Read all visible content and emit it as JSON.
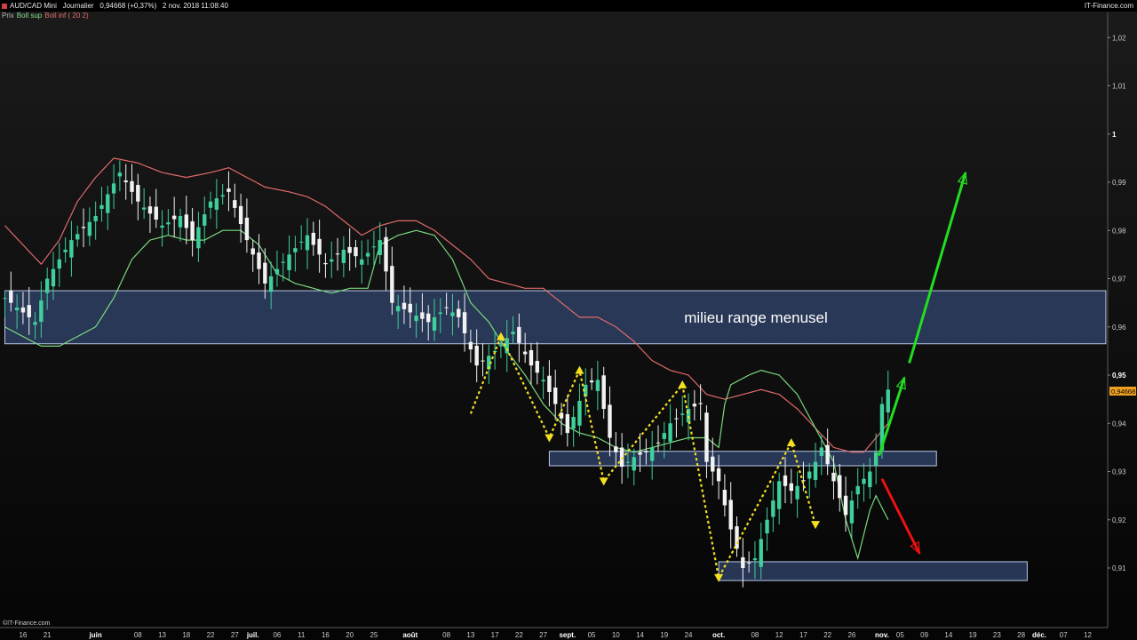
{
  "header": {
    "symbol": "AUD/CAD Mini",
    "period": "Journalier",
    "last": "0,94668",
    "change": "(+0,37%)",
    "datetime": "2 nov. 2018 11:08:40",
    "brand": "IT-Finance.com"
  },
  "legend": {
    "price": "Prix",
    "upper": "Boll sup",
    "lower": "Boll inf ( 20 2)"
  },
  "watermark": "©IT-Finance.com",
  "colors": {
    "up_candle": "#3ecf9a",
    "down_candle": "#f2f2f2",
    "upper_band": "#e06a6a",
    "lower_band": "#7ad87e",
    "zone_fill": "#2c3d60",
    "arrow_up": "#22dd22",
    "arrow_down": "#ee1111",
    "swing_line": "#f5e020",
    "price_tag": "#f0a020"
  },
  "chart_data": {
    "type": "candlestick",
    "ylim": [
      0.9,
      1.025
    ],
    "y_ticks": [
      {
        "v": 1.02,
        "label": "1,02",
        "bold": false
      },
      {
        "v": 1.01,
        "label": "1,01",
        "bold": false
      },
      {
        "v": 1.0,
        "label": "1",
        "bold": true
      },
      {
        "v": 0.99,
        "label": "0,99",
        "bold": false
      },
      {
        "v": 0.98,
        "label": "0,98",
        "bold": false
      },
      {
        "v": 0.97,
        "label": "0,97",
        "bold": false
      },
      {
        "v": 0.96,
        "label": "0,96",
        "bold": false
      },
      {
        "v": 0.95,
        "label": "0,95",
        "bold": true
      },
      {
        "v": 0.94,
        "label": "0,94",
        "bold": false
      },
      {
        "v": 0.93,
        "label": "0,93",
        "bold": false
      },
      {
        "v": 0.92,
        "label": "0,92",
        "bold": false
      },
      {
        "v": 0.91,
        "label": "0,91",
        "bold": false
      }
    ],
    "last_price_label": "0,94668",
    "last_price": 0.94668,
    "x_ticks": [
      {
        "i": 3,
        "label": "16",
        "bold": false
      },
      {
        "i": 7,
        "label": "21",
        "bold": false
      },
      {
        "i": 15,
        "label": "juin",
        "bold": true
      },
      {
        "i": 22,
        "label": "08",
        "bold": false
      },
      {
        "i": 26,
        "label": "13",
        "bold": false
      },
      {
        "i": 30,
        "label": "18",
        "bold": false
      },
      {
        "i": 34,
        "label": "22",
        "bold": false
      },
      {
        "i": 38,
        "label": "27",
        "bold": false
      },
      {
        "i": 41,
        "label": "juil.",
        "bold": true
      },
      {
        "i": 45,
        "label": "06",
        "bold": false
      },
      {
        "i": 49,
        "label": "11",
        "bold": false
      },
      {
        "i": 53,
        "label": "16",
        "bold": false
      },
      {
        "i": 57,
        "label": "20",
        "bold": false
      },
      {
        "i": 61,
        "label": "25",
        "bold": false
      },
      {
        "i": 67,
        "label": "août",
        "bold": true
      },
      {
        "i": 73,
        "label": "08",
        "bold": false
      },
      {
        "i": 77,
        "label": "13",
        "bold": false
      },
      {
        "i": 81,
        "label": "17",
        "bold": false
      },
      {
        "i": 85,
        "label": "22",
        "bold": false
      },
      {
        "i": 89,
        "label": "27",
        "bold": false
      },
      {
        "i": 93,
        "label": "sept.",
        "bold": true
      },
      {
        "i": 97,
        "label": "05",
        "bold": false
      },
      {
        "i": 101,
        "label": "10",
        "bold": false
      },
      {
        "i": 105,
        "label": "14",
        "bold": false
      },
      {
        "i": 109,
        "label": "19",
        "bold": false
      },
      {
        "i": 113,
        "label": "24",
        "bold": false
      },
      {
        "i": 118,
        "label": "oct.",
        "bold": true
      },
      {
        "i": 124,
        "label": "08",
        "bold": false
      },
      {
        "i": 128,
        "label": "12",
        "bold": false
      },
      {
        "i": 132,
        "label": "17",
        "bold": false
      },
      {
        "i": 136,
        "label": "22",
        "bold": false
      },
      {
        "i": 140,
        "label": "26",
        "bold": false
      },
      {
        "i": 145,
        "label": "nov.",
        "bold": true
      },
      {
        "i": 148,
        "label": "05",
        "bold": false
      },
      {
        "i": 152,
        "label": "09",
        "bold": false
      },
      {
        "i": 156,
        "label": "14",
        "bold": false
      },
      {
        "i": 160,
        "label": "19",
        "bold": false
      },
      {
        "i": 164,
        "label": "23",
        "bold": false
      },
      {
        "i": 168,
        "label": "28",
        "bold": false
      },
      {
        "i": 171,
        "label": "déc.",
        "bold": true
      },
      {
        "i": 175,
        "label": "07",
        "bold": false
      },
      {
        "i": 179,
        "label": "12",
        "bold": false
      }
    ],
    "price_key": [
      [
        0,
        0.966
      ],
      [
        5,
        0.961
      ],
      [
        7,
        0.97
      ],
      [
        11,
        0.978
      ],
      [
        15,
        0.983
      ],
      [
        19,
        0.992
      ],
      [
        22,
        0.986
      ],
      [
        26,
        0.981
      ],
      [
        29,
        0.983
      ],
      [
        31,
        0.978
      ],
      [
        34,
        0.986
      ],
      [
        37,
        0.988
      ],
      [
        40,
        0.978
      ],
      [
        43,
        0.969
      ],
      [
        47,
        0.975
      ],
      [
        50,
        0.979
      ],
      [
        53,
        0.973
      ],
      [
        56,
        0.976
      ],
      [
        59,
        0.974
      ],
      [
        62,
        0.978
      ],
      [
        64,
        0.965
      ],
      [
        67,
        0.963
      ],
      [
        70,
        0.961
      ],
      [
        73,
        0.964
      ],
      [
        75,
        0.962
      ],
      [
        78,
        0.952
      ],
      [
        81,
        0.955
      ],
      [
        84,
        0.959
      ],
      [
        87,
        0.952
      ],
      [
        89,
        0.949
      ],
      [
        91,
        0.944
      ],
      [
        93,
        0.938
      ],
      [
        96,
        0.948
      ],
      [
        98,
        0.949
      ],
      [
        100,
        0.937
      ],
      [
        102,
        0.931
      ],
      [
        104,
        0.933
      ],
      [
        106,
        0.934
      ],
      [
        108,
        0.936
      ],
      [
        110,
        0.94
      ],
      [
        113,
        0.943
      ],
      [
        115,
        0.944
      ],
      [
        116,
        0.932
      ],
      [
        118,
        0.928
      ],
      [
        120,
        0.918
      ],
      [
        122,
        0.91
      ],
      [
        124,
        0.912
      ],
      [
        126,
        0.92
      ],
      [
        128,
        0.928
      ],
      [
        130,
        0.926
      ],
      [
        132,
        0.928
      ],
      [
        134,
        0.932
      ],
      [
        135,
        0.935
      ],
      [
        137,
        0.928
      ],
      [
        139,
        0.921
      ],
      [
        141,
        0.927
      ],
      [
        143,
        0.93
      ],
      [
        144,
        0.934
      ],
      [
        145,
        0.944
      ],
      [
        146,
        0.947
      ]
    ],
    "upper_band": [
      [
        0,
        0.981
      ],
      [
        3,
        0.977
      ],
      [
        6,
        0.973
      ],
      [
        9,
        0.978
      ],
      [
        12,
        0.986
      ],
      [
        15,
        0.991
      ],
      [
        18,
        0.995
      ],
      [
        22,
        0.994
      ],
      [
        26,
        0.992
      ],
      [
        30,
        0.991
      ],
      [
        34,
        0.992
      ],
      [
        37,
        0.993
      ],
      [
        40,
        0.991
      ],
      [
        43,
        0.989
      ],
      [
        47,
        0.988
      ],
      [
        50,
        0.987
      ],
      [
        53,
        0.985
      ],
      [
        56,
        0.982
      ],
      [
        59,
        0.979
      ],
      [
        62,
        0.981
      ],
      [
        65,
        0.982
      ],
      [
        68,
        0.982
      ],
      [
        71,
        0.98
      ],
      [
        74,
        0.977
      ],
      [
        77,
        0.974
      ],
      [
        80,
        0.97
      ],
      [
        83,
        0.969
      ],
      [
        86,
        0.968
      ],
      [
        89,
        0.968
      ],
      [
        92,
        0.965
      ],
      [
        95,
        0.962
      ],
      [
        98,
        0.962
      ],
      [
        101,
        0.96
      ],
      [
        104,
        0.957
      ],
      [
        107,
        0.953
      ],
      [
        110,
        0.951
      ],
      [
        113,
        0.95
      ],
      [
        116,
        0.946
      ],
      [
        119,
        0.945
      ],
      [
        122,
        0.946
      ],
      [
        125,
        0.947
      ],
      [
        128,
        0.946
      ],
      [
        131,
        0.943
      ],
      [
        134,
        0.939
      ],
      [
        137,
        0.935
      ],
      [
        140,
        0.934
      ],
      [
        142,
        0.934
      ],
      [
        144,
        0.937
      ],
      [
        146,
        0.94
      ]
    ],
    "lower_band": [
      [
        0,
        0.96
      ],
      [
        3,
        0.958
      ],
      [
        6,
        0.956
      ],
      [
        9,
        0.956
      ],
      [
        12,
        0.958
      ],
      [
        15,
        0.96
      ],
      [
        18,
        0.966
      ],
      [
        21,
        0.974
      ],
      [
        24,
        0.978
      ],
      [
        27,
        0.979
      ],
      [
        30,
        0.978
      ],
      [
        33,
        0.978
      ],
      [
        36,
        0.98
      ],
      [
        39,
        0.98
      ],
      [
        42,
        0.977
      ],
      [
        45,
        0.971
      ],
      [
        48,
        0.969
      ],
      [
        51,
        0.968
      ],
      [
        54,
        0.967
      ],
      [
        57,
        0.968
      ],
      [
        60,
        0.968
      ],
      [
        62,
        0.977
      ],
      [
        65,
        0.979
      ],
      [
        68,
        0.98
      ],
      [
        71,
        0.979
      ],
      [
        74,
        0.974
      ],
      [
        77,
        0.965
      ],
      [
        80,
        0.961
      ],
      [
        83,
        0.955
      ],
      [
        86,
        0.95
      ],
      [
        89,
        0.944
      ],
      [
        92,
        0.94
      ],
      [
        95,
        0.938
      ],
      [
        98,
        0.937
      ],
      [
        101,
        0.935
      ],
      [
        104,
        0.934
      ],
      [
        107,
        0.935
      ],
      [
        110,
        0.936
      ],
      [
        113,
        0.937
      ],
      [
        116,
        0.937
      ],
      [
        118,
        0.935
      ],
      [
        119,
        0.944
      ],
      [
        120,
        0.948
      ],
      [
        123,
        0.95
      ],
      [
        125,
        0.951
      ],
      [
        128,
        0.95
      ],
      [
        131,
        0.946
      ],
      [
        134,
        0.939
      ],
      [
        137,
        0.932
      ],
      [
        139,
        0.92
      ],
      [
        141,
        0.912
      ],
      [
        143,
        0.922
      ],
      [
        144,
        0.925
      ],
      [
        146,
        0.92
      ]
    ],
    "upper_band_series": "Boll sup",
    "lower_band_series": "Boll inf",
    "zones": [
      {
        "i1": 0,
        "i2": 182,
        "y1": 0.9565,
        "y2": 0.9675,
        "label": "milieu range menusel"
      },
      {
        "i1": 90,
        "i2": 154,
        "y1": 0.9312,
        "y2": 0.9342,
        "label": ""
      },
      {
        "i1": 118,
        "i2": 169,
        "y1": 0.9074,
        "y2": 0.9113,
        "label": ""
      }
    ],
    "swing_path": [
      [
        77,
        0.942
      ],
      [
        82,
        0.958
      ],
      [
        90,
        0.937
      ],
      [
        95,
        0.951
      ],
      [
        99,
        0.928
      ],
      [
        112,
        0.948
      ],
      [
        118,
        0.908
      ],
      [
        130,
        0.936
      ],
      [
        134,
        0.919
      ]
    ],
    "arrows": [
      {
        "from": [
          144.5,
          0.9333
        ],
        "to": [
          148.7,
          0.9495
        ],
        "color": "arrow_up"
      },
      {
        "from": [
          149.5,
          0.9525
        ],
        "to": [
          158.8,
          0.992
        ],
        "color": "arrow_up"
      },
      {
        "from": [
          145.0,
          0.9285
        ],
        "to": [
          151.2,
          0.913
        ],
        "color": "arrow_down"
      }
    ]
  }
}
